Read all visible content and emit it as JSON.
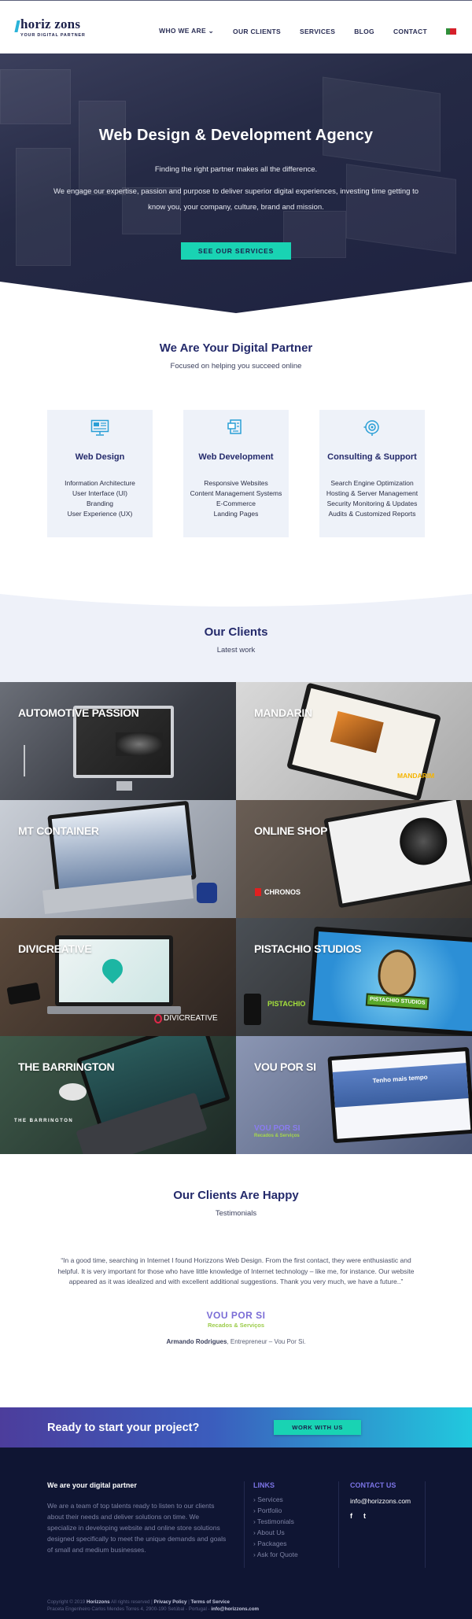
{
  "header": {
    "logo_text": "oriz zons",
    "logo_tagline": "YOUR DIGITAL PARTNER",
    "nav": [
      {
        "label": "WHO WE ARE ⌄"
      },
      {
        "label": "OUR CLIENTS"
      },
      {
        "label": "SERVICES"
      },
      {
        "label": "BLOG"
      },
      {
        "label": "CONTACT"
      }
    ]
  },
  "hero": {
    "title": "Web Design & Development Agency",
    "subtitle": "Finding the right partner makes all the difference.",
    "description": "We engage our expertise, passion and purpose to deliver superior digital experiences, investing time getting to know you, your company, culture, brand and mission.",
    "button": "SEE OUR SERVICES"
  },
  "partner": {
    "title": "We Are Your Digital Partner",
    "subtitle": "Focused on helping you succeed online",
    "cards": [
      {
        "title": "Web Design",
        "items": [
          "Information Architecture",
          "User Interface (UI)",
          "Branding",
          "User Experience (UX)"
        ]
      },
      {
        "title": "Web Development",
        "items": [
          "Responsive Websites",
          "Content Management Systems",
          "E-Commerce",
          "Landing Pages"
        ]
      },
      {
        "title": "Consulting & Support",
        "items": [
          "Search Engine Optimization",
          "Hosting & Server Management",
          "Security Monitoring & Updates",
          "Audits & Customized Reports"
        ]
      }
    ]
  },
  "clients": {
    "title": "Our Clients",
    "subtitle": "Latest work",
    "tiles": [
      {
        "label": "AUTOMOTIVE PASSION"
      },
      {
        "label": "MANDARIN",
        "brand": "MANDARIM"
      },
      {
        "label": "MT CONTAINER"
      },
      {
        "label": "ONLINE SHOP",
        "brand": "CHRONOS"
      },
      {
        "label": "DIVICREATIVE",
        "brand": "DIVICREATIVE"
      },
      {
        "label": "PISTACHIO STUDIOS",
        "brand": "PISTACHIO",
        "screen_text": "PISTACHIO STUDIOS"
      },
      {
        "label": "THE BARRINGTON",
        "brand": "THE BARRINGTON"
      },
      {
        "label": "VOU POR SI",
        "brand": "VOU POR SI",
        "brand_sub": "Recados & Serviços",
        "screen_text": "Tenho mais tempo"
      }
    ]
  },
  "testimonials": {
    "title": "Our Clients Are Happy",
    "subtitle": "Testimonials",
    "quote": "“In a good time, searching in Internet I found Horizzons Web Design. From the first contact, they were enthusiastic and helpful. It is very important for those who have little knowledge of Internet technology – like me, for instance. Our website appeared as it was idealized and with excellent additional suggestions. Thank you very much, we have a future..”",
    "company": "VOU POR SI",
    "company_sub": "Recados & Serviços",
    "author_name": "Armando Rodrigues",
    "author_role": ", Entrepreneur – Vou Por Si."
  },
  "cta": {
    "text": "Ready to start your project?",
    "button": "WORK WITH US"
  },
  "footer": {
    "about_title": "We are your digital partner",
    "about_text": "We are a team of top talents ready to listen to our clients about their needs and deliver solutions on time. We specialize in developing website and online store solutions designed specifically to meet the unique demands and goals of small and medium businesses.",
    "links_title": "LINKS",
    "links": [
      "Services",
      "Portfolio",
      "Testimonials",
      "About Us",
      "Packages",
      "Ask for Quote"
    ],
    "contact_title": "CONTACT US",
    "email": "info@horizzons.com",
    "social": [
      "f",
      "t"
    ],
    "copyright_prefix": "Copyright © 2019",
    "copyright_brand": "Horizzons",
    "copyright_suffix": " All rights reserved |",
    "privacy": "Privacy Policy",
    "terms": "Terms of Service",
    "address": "Praceta Engenheiro Carlos Mendes Torres 4, 2900-190 Setúbal - Portugal -",
    "address_email": "info@horizzons.com"
  },
  "colors": {
    "navy": "#242a6b",
    "teal": "#19d3b3",
    "footer_bg": "#0f1533",
    "accent_purple": "#7b74e6"
  }
}
